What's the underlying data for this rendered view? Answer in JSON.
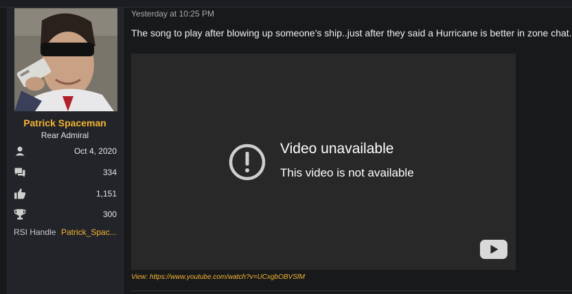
{
  "user": {
    "name": "Patrick Spaceman",
    "title": "Rear Admiral",
    "stats": [
      {
        "icon": "user-icon",
        "value": "Oct 4, 2020"
      },
      {
        "icon": "messages-icon",
        "value": "334"
      },
      {
        "icon": "thumbs-up-icon",
        "value": "1,151"
      },
      {
        "icon": "trophy-icon",
        "value": "300"
      }
    ],
    "rsi_label": "RSI Handle",
    "rsi_value": "Patrick_Spac..."
  },
  "post": {
    "timestamp": "Yesterday at 10:25 PM",
    "message": "The song to play after blowing up someone's ship..just after they said a Hurricane is better in zone chat...",
    "video": {
      "title": "Video unavailable",
      "subtitle": "This video is not available",
      "link_text": "View: https://www.youtube.com/watch?v=UCxgbOBVSfM"
    }
  },
  "colors": {
    "accent": "#f4b533",
    "sidebar_bg": "#222429",
    "page_bg": "#18191b",
    "video_bg": "#282828"
  }
}
